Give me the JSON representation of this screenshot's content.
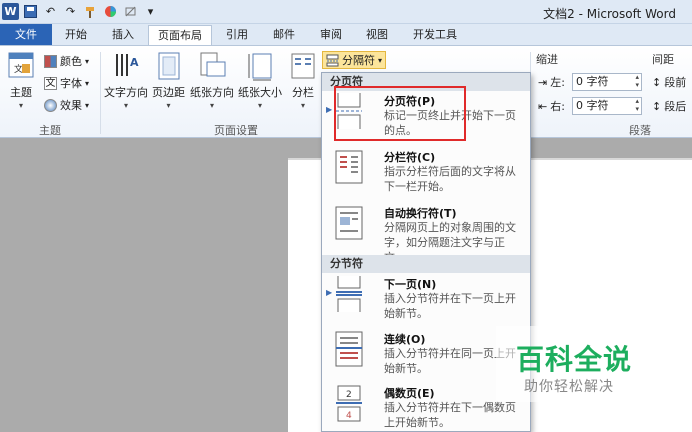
{
  "window": {
    "title": "文档2 - Microsoft Word"
  },
  "qat": {
    "undo": "↶",
    "redo": "↷",
    "customize": "▾"
  },
  "tabs": [
    "文件",
    "开始",
    "插入",
    "页面布局",
    "引用",
    "邮件",
    "审阅",
    "视图",
    "开发工具"
  ],
  "ribbon": {
    "themes": {
      "big": "主题",
      "colors": "颜色",
      "fonts": "字体",
      "effects": "效果",
      "group": "主题"
    },
    "page_setup": {
      "buttons": [
        "文字方向",
        "页边距",
        "纸张方向",
        "纸张大小",
        "分栏"
      ],
      "breaks_button": "分隔符",
      "group": "页面设置"
    },
    "paragraph": {
      "indent_label": "缩进",
      "left_label": "左:",
      "left_value": "0 字符",
      "right_label": "右:",
      "right_value": "0 字符",
      "spacing_label": "间距",
      "before_label": "段前",
      "after_label": "段后",
      "group": "段落"
    }
  },
  "dropdown": {
    "sections": [
      {
        "header": "分页符",
        "items": [
          {
            "title": "分页符(P)",
            "desc": "标记一页终止并开始下一页的点。",
            "icon": "page-break-icon"
          },
          {
            "title": "分栏符(C)",
            "desc": "指示分栏符后面的文字将从下一栏开始。",
            "icon": "column-break-icon"
          },
          {
            "title": "自动换行符(T)",
            "desc": "分隔网页上的对象周围的文字，如分隔题注文字与正文。",
            "icon": "text-wrapping-break-icon"
          }
        ]
      },
      {
        "header": "分节符",
        "items": [
          {
            "title": "下一页(N)",
            "desc": "插入分节符并在下一页上开始新节。",
            "icon": "next-page-section-icon"
          },
          {
            "title": "连续(O)",
            "desc": "插入分节符并在同一页上开始新节。",
            "icon": "continuous-section-icon"
          },
          {
            "title": "偶数页(E)",
            "desc": "插入分节符并在下一偶数页上开始新节。",
            "icon": "even-page-section-icon"
          }
        ]
      }
    ]
  },
  "watermark": {
    "main": "百科全说",
    "sub": "助你轻松解决"
  },
  "colors": {
    "file_tab": "#2B64B6",
    "highlight": "#E02A2A",
    "watermark": "#1DAE5E"
  }
}
